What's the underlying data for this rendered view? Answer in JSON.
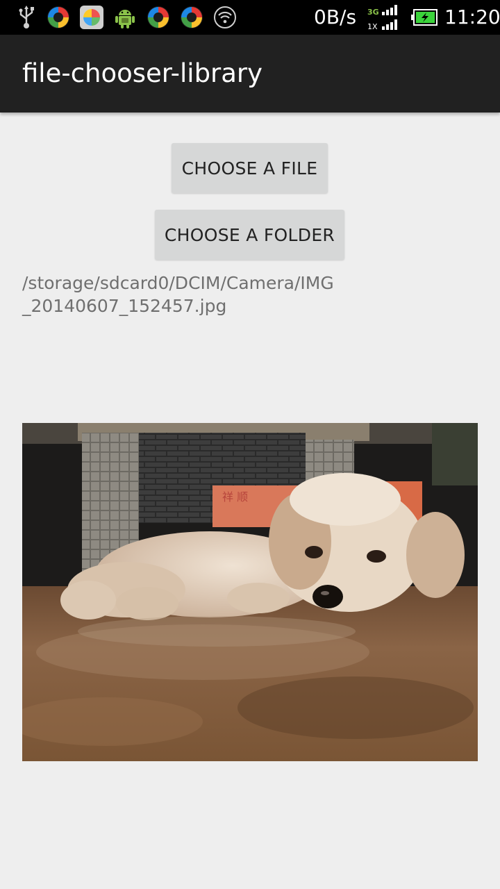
{
  "status_bar": {
    "net_speed": "0B/s",
    "network_3g": "3G",
    "network_1x": "1X",
    "clock": "11:20",
    "icons": [
      "usb-icon",
      "app-icon-colorful",
      "gallery-app-icon",
      "android-icon",
      "app-icon-colorful",
      "app-icon-colorful",
      "wifi-hotspot-icon",
      "signal-icon",
      "battery-charging-icon"
    ]
  },
  "action_bar": {
    "title": "file-chooser-library"
  },
  "main": {
    "choose_file_label": "CHOOSE A FILE",
    "choose_folder_label": "CHOOSE A FOLDER",
    "selected_path": "/storage/sdcard0/DCIM/Camera/IMG_20140607_152457.jpg",
    "photo_subject": "poodle puppy lying on reflective floor",
    "box_text": "祥 顺"
  },
  "colors": {
    "status_bar_bg": "#000000",
    "action_bar_bg": "#212121",
    "page_bg": "#eeeeee",
    "button_bg": "#d6d7d7",
    "path_text": "#6f6f6f",
    "battery_green": "#3bd43b"
  }
}
